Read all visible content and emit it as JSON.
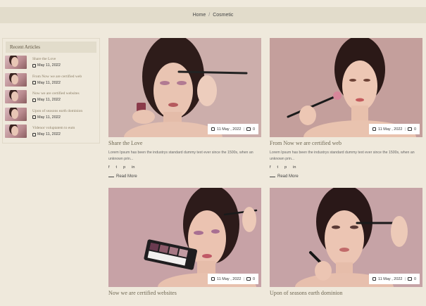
{
  "breadcrumb": {
    "home": "Home",
    "separator": "/",
    "current": "Cosmetic"
  },
  "sidebar": {
    "title": "Recent Articles",
    "articles": [
      {
        "title": "Share the Love",
        "date": "May 11, 2022"
      },
      {
        "title": "From Now we are certified web",
        "date": "May 11, 2022"
      },
      {
        "title": "Now we are certified websites",
        "date": "May 11, 2022"
      },
      {
        "title": "Upon of seasons earth dominion",
        "date": "May 11, 2022"
      },
      {
        "title": "Videnor voluptatem to eum",
        "date": "May 11, 2022"
      }
    ]
  },
  "posts": [
    {
      "title": "Share the Love",
      "date": "11 May , 2022",
      "comments": "0",
      "excerpt": "Lorem Ipsum has been the industrys standard dummy text ever since the 1500s, when an unknown prin...",
      "read_more": "Read More"
    },
    {
      "title": "From Now we are certified web",
      "date": "11 May , 2022",
      "comments": "0",
      "excerpt": "Lorem Ipsum has been the industrys standard dummy text ever since the 1500s, when an unknown prin...",
      "read_more": "Read More"
    },
    {
      "title": "Now we are certified websites",
      "date": "11 May , 2022",
      "comments": "0"
    },
    {
      "title": "Upon of seasons earth dominion",
      "date": "11 May , 2022",
      "comments": "0"
    }
  ],
  "social": {
    "facebook": "f",
    "twitter": "t",
    "pinterest": "p",
    "linkedin": "in"
  },
  "colors": {
    "background": "#efe9dc",
    "bar": "#e2dccb",
    "photo_bg": "#c9a6a6"
  }
}
